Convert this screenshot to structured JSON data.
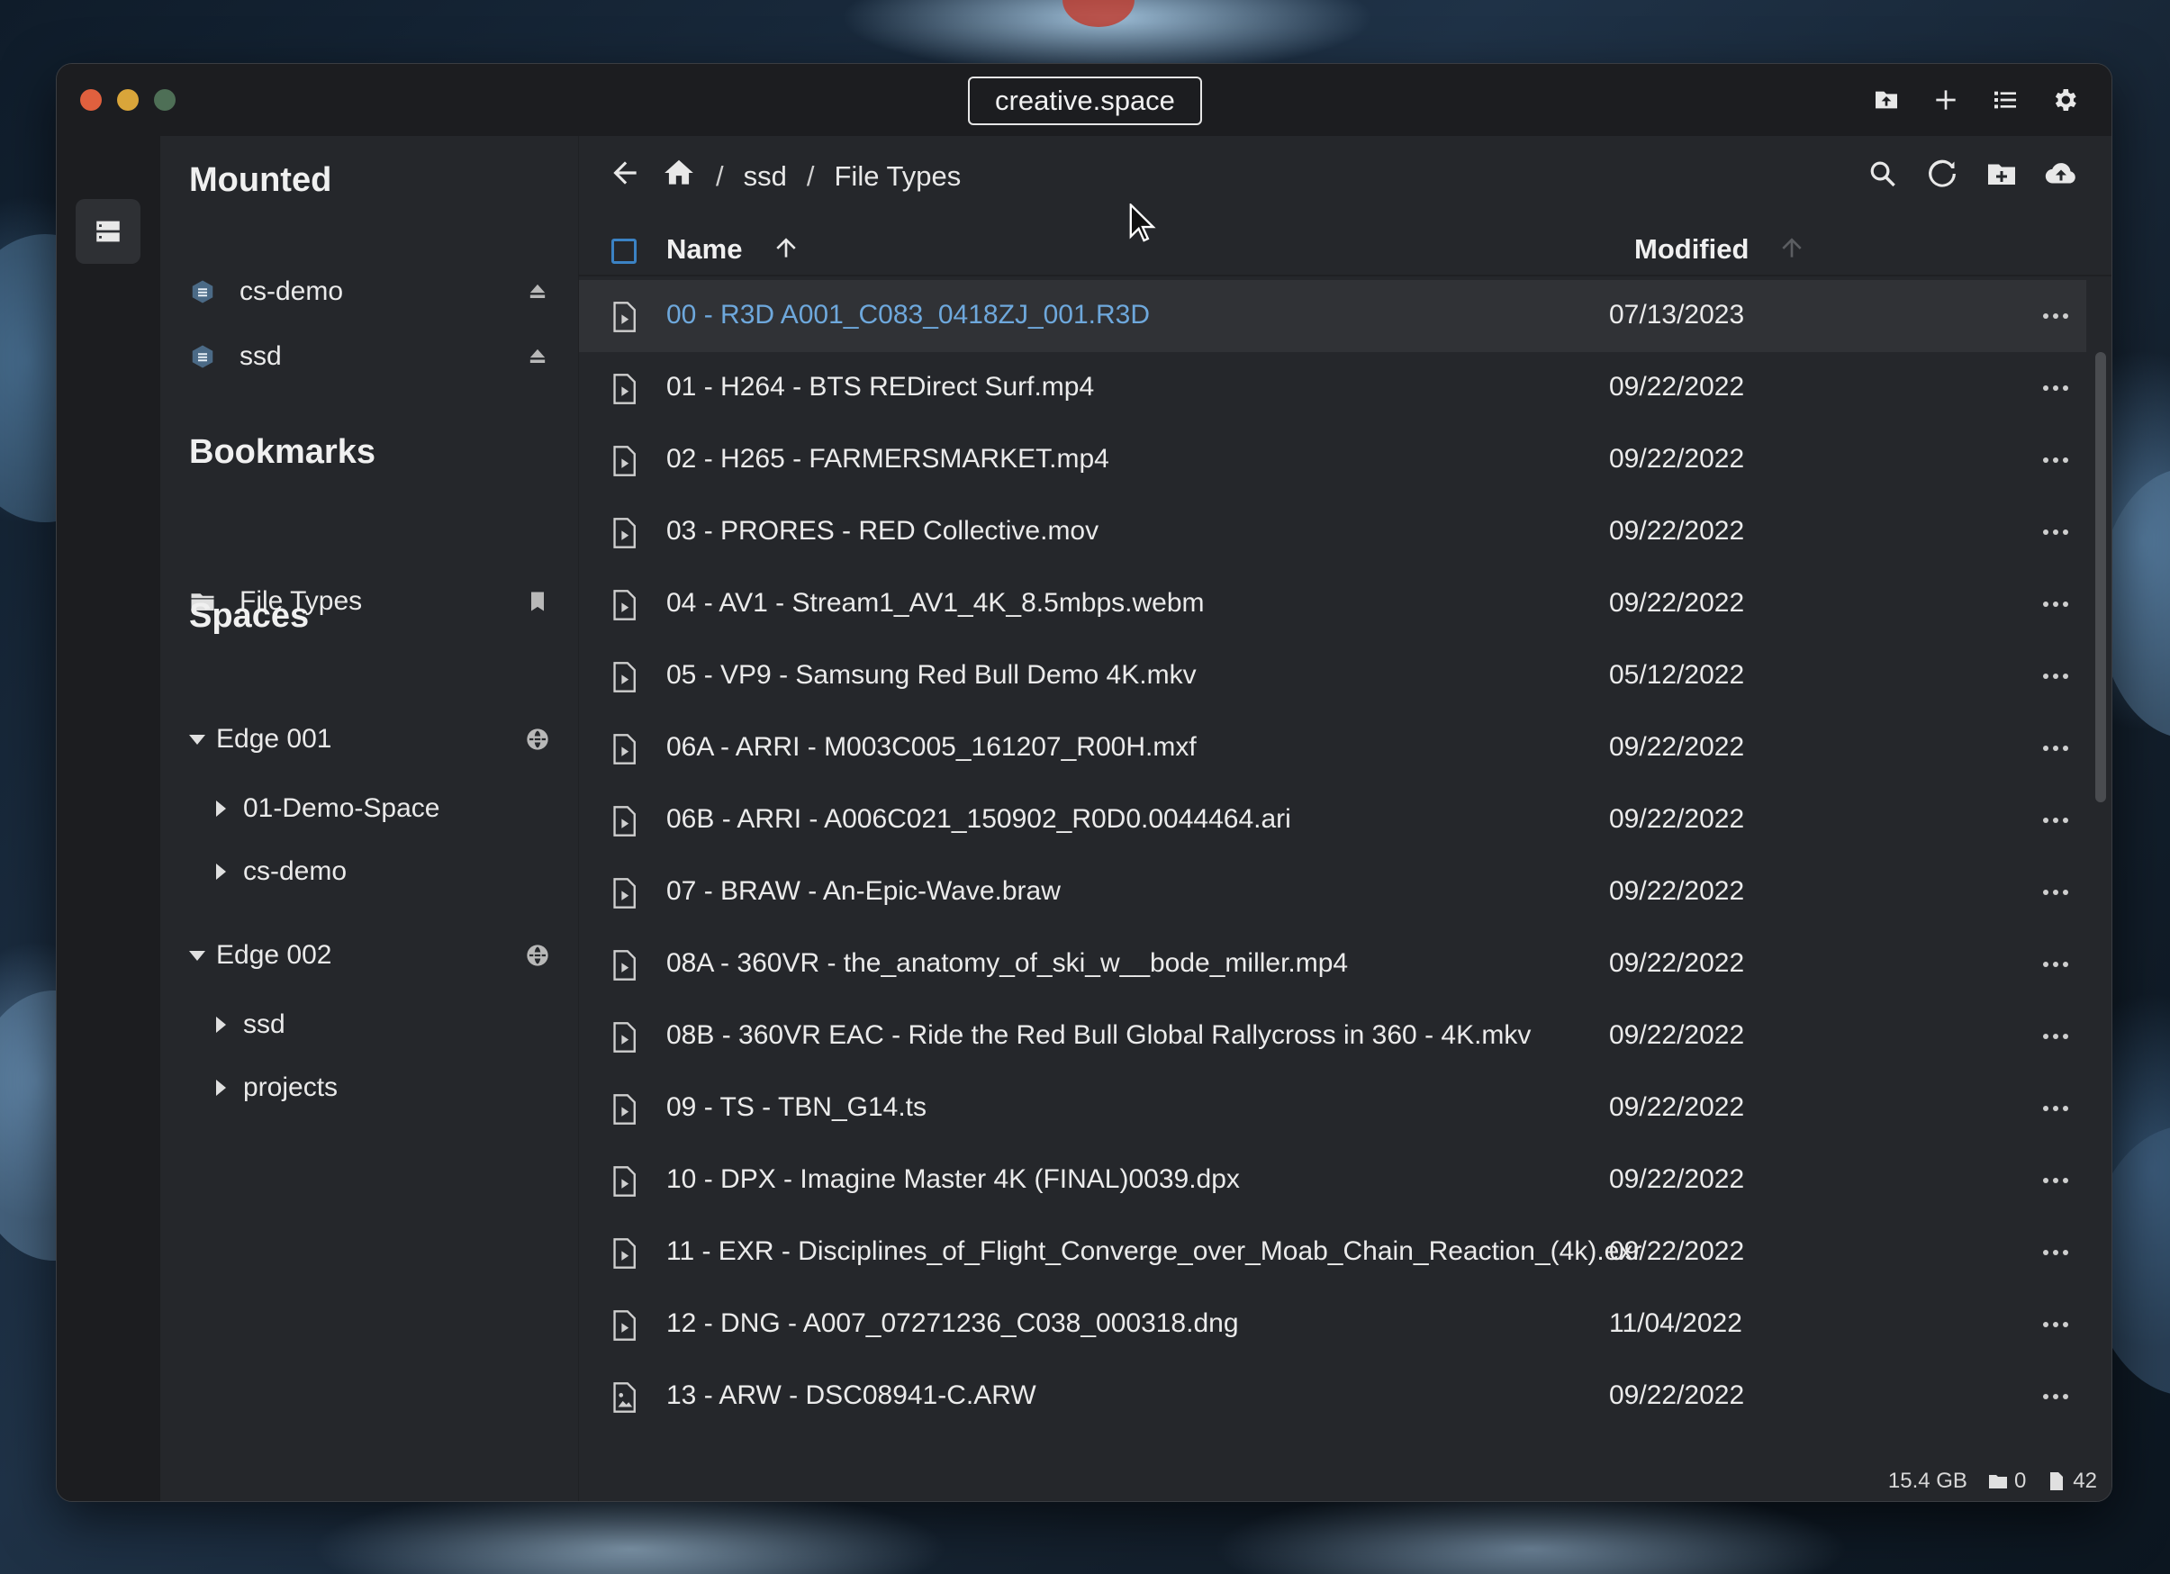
{
  "window": {
    "title": "creative.space"
  },
  "sidebar": {
    "mounted_title": "Mounted",
    "mounted": [
      {
        "label": "cs-demo"
      },
      {
        "label": "ssd"
      }
    ],
    "bookmarks_title": "Bookmarks",
    "bookmarks": [
      {
        "label": "File Types"
      }
    ],
    "spaces_title": "Spaces",
    "spaces": [
      {
        "label": "Edge 001",
        "children": [
          {
            "label": "01-Demo-Space"
          },
          {
            "label": "cs-demo"
          }
        ]
      },
      {
        "label": "Edge 002",
        "children": [
          {
            "label": "ssd"
          },
          {
            "label": "projects"
          }
        ]
      }
    ]
  },
  "breadcrumb": {
    "items": [
      "ssd",
      "File Types"
    ],
    "separator": "/"
  },
  "columns": {
    "name": "Name",
    "modified": "Modified"
  },
  "files": [
    {
      "name": "00 - R3D A001_C083_0418ZJ_001.R3D",
      "modified": "07/13/2023",
      "icon": "video-file-icon",
      "selected": true
    },
    {
      "name": "01 - H264 - BTS REDirect Surf.mp4",
      "modified": "09/22/2022",
      "icon": "video-file-icon"
    },
    {
      "name": "02 - H265 - FARMERSMARKET.mp4",
      "modified": "09/22/2022",
      "icon": "video-file-icon"
    },
    {
      "name": "03 - PRORES - RED Collective.mov",
      "modified": "09/22/2022",
      "icon": "video-file-icon"
    },
    {
      "name": "04 - AV1 - Stream1_AV1_4K_8.5mbps.webm",
      "modified": "09/22/2022",
      "icon": "video-file-icon"
    },
    {
      "name": "05 - VP9 - Samsung Red Bull Demo 4K.mkv",
      "modified": "05/12/2022",
      "icon": "video-file-icon"
    },
    {
      "name": "06A - ARRI - M003C005_161207_R00H.mxf",
      "modified": "09/22/2022",
      "icon": "video-file-icon"
    },
    {
      "name": "06B - ARRI - A006C021_150902_R0D0.0044464.ari",
      "modified": "09/22/2022",
      "icon": "video-file-icon"
    },
    {
      "name": "07 - BRAW - An-Epic-Wave.braw",
      "modified": "09/22/2022",
      "icon": "video-file-icon"
    },
    {
      "name": "08A - 360VR - the_anatomy_of_ski_w__bode_miller.mp4",
      "modified": "09/22/2022",
      "icon": "video-file-icon"
    },
    {
      "name": "08B - 360VR EAC - Ride the Red Bull Global Rallycross in 360 - 4K.mkv",
      "modified": "09/22/2022",
      "icon": "video-file-icon"
    },
    {
      "name": "09 - TS - TBN_G14.ts",
      "modified": "09/22/2022",
      "icon": "video-file-icon"
    },
    {
      "name": "10 - DPX - Imagine Master 4K (FINAL)0039.dpx",
      "modified": "09/22/2022",
      "icon": "video-file-icon"
    },
    {
      "name": "11 - EXR - Disciplines_of_Flight_Converge_over_Moab_Chain_Reaction_(4k).exr",
      "modified": "09/22/2022",
      "icon": "video-file-icon"
    },
    {
      "name": "12 - DNG - A007_07271236_C038_000318.dng",
      "modified": "11/04/2022",
      "icon": "video-file-icon"
    },
    {
      "name": "13 - ARW - DSC08941-C.ARW",
      "modified": "09/22/2022",
      "icon": "image-file-icon"
    }
  ],
  "status": {
    "size": "15.4 GB",
    "folders": "0",
    "files": "42"
  },
  "colors": {
    "accent": "#3b82c4",
    "selected_text": "#6ea8dc",
    "background": "#25272b"
  }
}
